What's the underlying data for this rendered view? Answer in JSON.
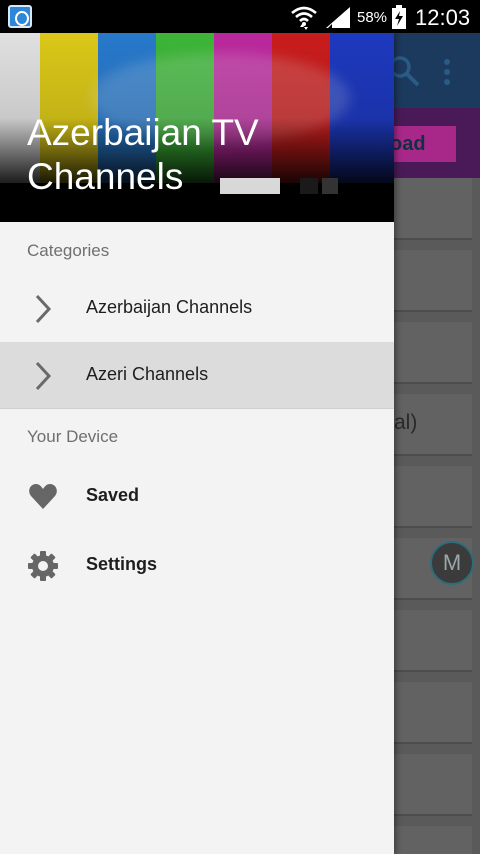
{
  "status_bar": {
    "battery_percent": "58%",
    "time": "12:03",
    "icons": [
      "app-notification-icon",
      "wifi-icon",
      "signal-icon",
      "battery-charging-icon"
    ]
  },
  "background_app": {
    "button_partial_label": "oad",
    "list_partial_text": "al)",
    "fab_label": "M",
    "icons": [
      "search-icon",
      "overflow-menu-icon"
    ]
  },
  "drawer": {
    "header": {
      "title": "Azerbaijan TV Channels",
      "color_bars": [
        "#ececec",
        "#e6d21a",
        "#2a7fd6",
        "#3fbf3a",
        "#c52aa6",
        "#d41e1e",
        "#1f3cc8"
      ]
    },
    "sections": [
      {
        "label": "Categories",
        "items": [
          {
            "label": "Azerbaijan Channels",
            "icon": "chevron-right-icon",
            "active": false
          },
          {
            "label": "Azeri Channels",
            "icon": "chevron-right-icon",
            "active": true
          }
        ]
      },
      {
        "label": "Your Device",
        "items": [
          {
            "label": "Saved",
            "icon": "heart-icon"
          },
          {
            "label": "Settings",
            "icon": "gear-icon"
          }
        ]
      }
    ]
  },
  "colors": {
    "drawer_background": "#f3f3f3",
    "active_item": "#dcdcdc",
    "status_bar": "#000000",
    "toolbar": "#1c3a5e"
  }
}
